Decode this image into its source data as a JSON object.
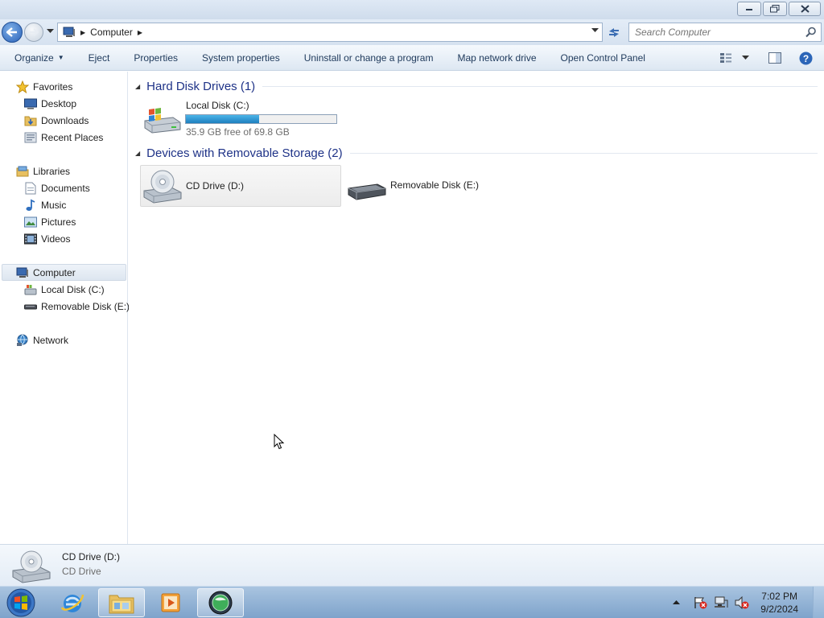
{
  "window": {
    "controls": [
      "minimize-icon",
      "restore-icon",
      "close-icon"
    ]
  },
  "address": {
    "crumb": "Computer",
    "search_placeholder": "Search Computer"
  },
  "toolbar": {
    "organize": "Organize",
    "eject": "Eject",
    "properties": "Properties",
    "system_properties": "System properties",
    "uninstall": "Uninstall or change a program",
    "map_drive": "Map network drive",
    "control_panel": "Open Control Panel"
  },
  "nav": {
    "favorites": "Favorites",
    "desktop": "Desktop",
    "downloads": "Downloads",
    "recent": "Recent Places",
    "libraries": "Libraries",
    "documents": "Documents",
    "music": "Music",
    "pictures": "Pictures",
    "videos": "Videos",
    "computer": "Computer",
    "local_disk": "Local Disk (C:)",
    "removable": "Removable Disk (E:)",
    "network": "Network"
  },
  "content": {
    "hdd_group": "Hard Disk Drives (1)",
    "removable_group": "Devices with Removable Storage (2)",
    "local_disk": {
      "name": "Local Disk (C:)",
      "free": "35.9 GB free of 69.8 GB",
      "used_fraction": 0.486
    },
    "cd_drive": {
      "name": "CD Drive (D:)"
    },
    "removable_disk": {
      "name": "Removable Disk (E:)"
    }
  },
  "details": {
    "name": "CD Drive (D:)",
    "type": "CD Drive"
  },
  "taskbar": {
    "items": [
      "start-orb-icon",
      "internet-explorer-icon",
      "windows-explorer-icon",
      "media-player-icon",
      "app-globe-icon"
    ],
    "time": "7:02 PM",
    "date": "9/2/2024"
  }
}
